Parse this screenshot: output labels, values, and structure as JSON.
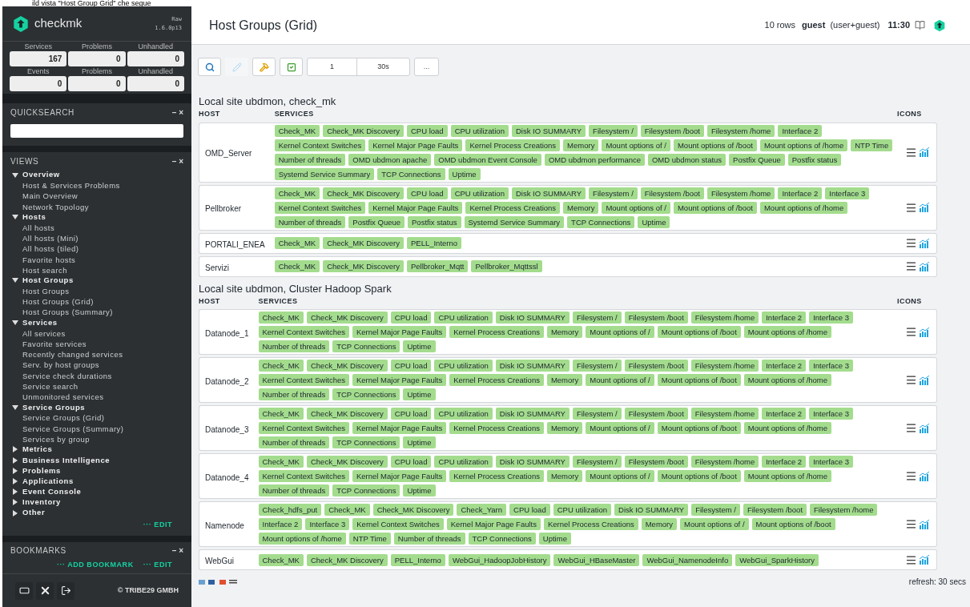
{
  "caption": "ild vista \"Host Group Grid\" che segue",
  "sidebar": {
    "logo": "checkmk",
    "edition": "Raw",
    "version": "1.6.0p13",
    "stats": [
      {
        "label": "Services",
        "value": "167"
      },
      {
        "label": "Problems",
        "value": "0"
      },
      {
        "label": "Unhandled",
        "value": "0"
      },
      {
        "label": "Events",
        "value": "0"
      },
      {
        "label": "Problems",
        "value": "0"
      },
      {
        "label": "Unhandled",
        "value": "0"
      }
    ],
    "quicksearch": {
      "title": "QUICKSEARCH",
      "controls": "– ×"
    },
    "views": {
      "title": "VIEWS",
      "controls": "– ×",
      "edit": "··· EDIT",
      "items": [
        {
          "label": "Overview",
          "expanded": true,
          "children": [
            "Host & Services Problems",
            "Main Overview",
            "Network Topology"
          ]
        },
        {
          "label": "Hosts",
          "expanded": true,
          "children": [
            "All hosts",
            "All hosts (Mini)",
            "All hosts (tiled)",
            "Favorite hosts",
            "Host search"
          ]
        },
        {
          "label": "Host Groups",
          "expanded": true,
          "children": [
            "Host Groups",
            "Host Groups (Grid)",
            "Host Groups (Summary)"
          ]
        },
        {
          "label": "Services",
          "expanded": true,
          "children": [
            "All services",
            "Favorite services",
            "Recently changed services",
            "Serv. by host groups",
            "Service check durations",
            "Service search",
            "Unmonitored services"
          ]
        },
        {
          "label": "Service Groups",
          "expanded": true,
          "children": [
            "Service Groups (Grid)",
            "Service Groups (Summary)",
            "Services by group"
          ]
        },
        {
          "label": "Metrics",
          "expanded": false
        },
        {
          "label": "Business Intelligence",
          "expanded": false
        },
        {
          "label": "Problems",
          "expanded": false
        },
        {
          "label": "Applications",
          "expanded": false
        },
        {
          "label": "Event Console",
          "expanded": false
        },
        {
          "label": "Inventory",
          "expanded": false
        },
        {
          "label": "Other",
          "expanded": false
        }
      ]
    },
    "bookmarks": {
      "title": "BOOKMARKS",
      "controls": "– ×",
      "add": "··· ADD BOOKMARK",
      "edit": "··· EDIT"
    },
    "footer": "© TRIBE29 GMBH"
  },
  "header": {
    "title": "Host Groups (Grid)",
    "rows": "10 rows",
    "user": "guest",
    "role": "(user+guest)",
    "time": "11:30"
  },
  "toolbar": {
    "buttons": [
      {
        "kind": "search",
        "disabled": false
      },
      {
        "kind": "edit",
        "disabled": true
      },
      {
        "kind": "hammer",
        "disabled": false
      },
      {
        "kind": "checkbox",
        "disabled": false
      }
    ],
    "page": "1",
    "refresh": "30s",
    "more": "..."
  },
  "groups": [
    {
      "title": "Local site ubdmon, check_mk",
      "columns": [
        "HOST",
        "SERVICES",
        "ICONS"
      ],
      "hosts": [
        {
          "name": "OMD_Server",
          "services": [
            "Check_MK",
            "Check_MK Discovery",
            "CPU load",
            "CPU utilization",
            "Disk IO SUMMARY",
            "Filesystem /",
            "Filesystem /boot",
            "Filesystem /home",
            "Interface 2",
            "Kernel Context Switches",
            "Kernel Major Page Faults",
            "Kernel Process Creations",
            "Memory",
            "Mount options of /",
            "Mount options of /boot",
            "Mount options of /home",
            "NTP Time",
            "Number of threads",
            "OMD ubdmon apache",
            "OMD ubdmon Event Console",
            "OMD ubdmon performance",
            "OMD ubdmon status",
            "Postfix Queue",
            "Postfix status",
            "Systemd Service Summary",
            "TCP Connections",
            "Uptime"
          ]
        },
        {
          "name": "Pellbroker",
          "services": [
            "Check_MK",
            "Check_MK Discovery",
            "CPU load",
            "CPU utilization",
            "Disk IO SUMMARY",
            "Filesystem /",
            "Filesystem /boot",
            "Filesystem /home",
            "Interface 2",
            "Interface 3",
            "Kernel Context Switches",
            "Kernel Major Page Faults",
            "Kernel Process Creations",
            "Memory",
            "Mount options of /",
            "Mount options of /boot",
            "Mount options of /home",
            "Number of threads",
            "Postfix Queue",
            "Postfix status",
            "Systemd Service Summary",
            "TCP Connections",
            "Uptime"
          ]
        },
        {
          "name": "PORTALI_ENEA",
          "services": [
            "Check_MK",
            "Check_MK Discovery",
            "PELL_Interno"
          ]
        },
        {
          "name": "Servizi",
          "services": [
            "Check_MK",
            "Check_MK Discovery",
            "Pellbroker_Mqtt",
            "Pellbroker_Mqttssl"
          ]
        }
      ]
    },
    {
      "title": "Local site ubdmon, Cluster Hadoop Spark",
      "columns": [
        "HOST",
        "SERVICES",
        "ICONS"
      ],
      "hosts": [
        {
          "name": "Datanode_1",
          "services": [
            "Check_MK",
            "Check_MK Discovery",
            "CPU load",
            "CPU utilization",
            "Disk IO SUMMARY",
            "Filesystem /",
            "Filesystem /boot",
            "Filesystem /home",
            "Interface 2",
            "Interface 3",
            "Kernel Context Switches",
            "Kernel Major Page Faults",
            "Kernel Process Creations",
            "Memory",
            "Mount options of /",
            "Mount options of /boot",
            "Mount options of /home",
            "Number of threads",
            "TCP Connections",
            "Uptime"
          ]
        },
        {
          "name": "Datanode_2",
          "services": [
            "Check_MK",
            "Check_MK Discovery",
            "CPU load",
            "CPU utilization",
            "Disk IO SUMMARY",
            "Filesystem /",
            "Filesystem /boot",
            "Filesystem /home",
            "Interface 2",
            "Interface 3",
            "Kernel Context Switches",
            "Kernel Major Page Faults",
            "Kernel Process Creations",
            "Memory",
            "Mount options of /",
            "Mount options of /boot",
            "Mount options of /home",
            "Number of threads",
            "TCP Connections",
            "Uptime"
          ]
        },
        {
          "name": "Datanode_3",
          "services": [
            "Check_MK",
            "Check_MK Discovery",
            "CPU load",
            "CPU utilization",
            "Disk IO SUMMARY",
            "Filesystem /",
            "Filesystem /boot",
            "Filesystem /home",
            "Interface 2",
            "Interface 3",
            "Kernel Context Switches",
            "Kernel Major Page Faults",
            "Kernel Process Creations",
            "Memory",
            "Mount options of /",
            "Mount options of /boot",
            "Mount options of /home",
            "Number of threads",
            "TCP Connections",
            "Uptime"
          ]
        },
        {
          "name": "Datanode_4",
          "services": [
            "Check_MK",
            "Check_MK Discovery",
            "CPU load",
            "CPU utilization",
            "Disk IO SUMMARY",
            "Filesystem /",
            "Filesystem /boot",
            "Filesystem /home",
            "Interface 2",
            "Interface 3",
            "Kernel Context Switches",
            "Kernel Major Page Faults",
            "Kernel Process Creations",
            "Memory",
            "Mount options of /",
            "Mount options of /boot",
            "Mount options of /home",
            "Number of threads",
            "TCP Connections",
            "Uptime"
          ]
        },
        {
          "name": "Namenode",
          "services": [
            "Check_hdfs_put",
            "Check_MK",
            "Check_MK Discovery",
            "Check_Yarn",
            "CPU load",
            "CPU utilization",
            "Disk IO SUMMARY",
            "Filesystem /",
            "Filesystem /boot",
            "Filesystem /home",
            "Interface 2",
            "Interface 3",
            "Kernel Context Switches",
            "Kernel Major Page Faults",
            "Kernel Process Creations",
            "Memory",
            "Mount options of /",
            "Mount options of /boot",
            "Mount options of /home",
            "NTP Time",
            "Number of threads",
            "TCP Connections",
            "Uptime"
          ]
        },
        {
          "name": "WebGui",
          "services": [
            "Check_MK",
            "Check_MK Discovery",
            "PELL_Interno",
            "WebGui_HadoopJobHistory",
            "WebGui_HBaseMaster",
            "WebGui_NamenodeInfo",
            "WebGui_SparkHistory"
          ]
        }
      ]
    }
  ],
  "status": {
    "refresh": "refresh: 30 secs"
  }
}
